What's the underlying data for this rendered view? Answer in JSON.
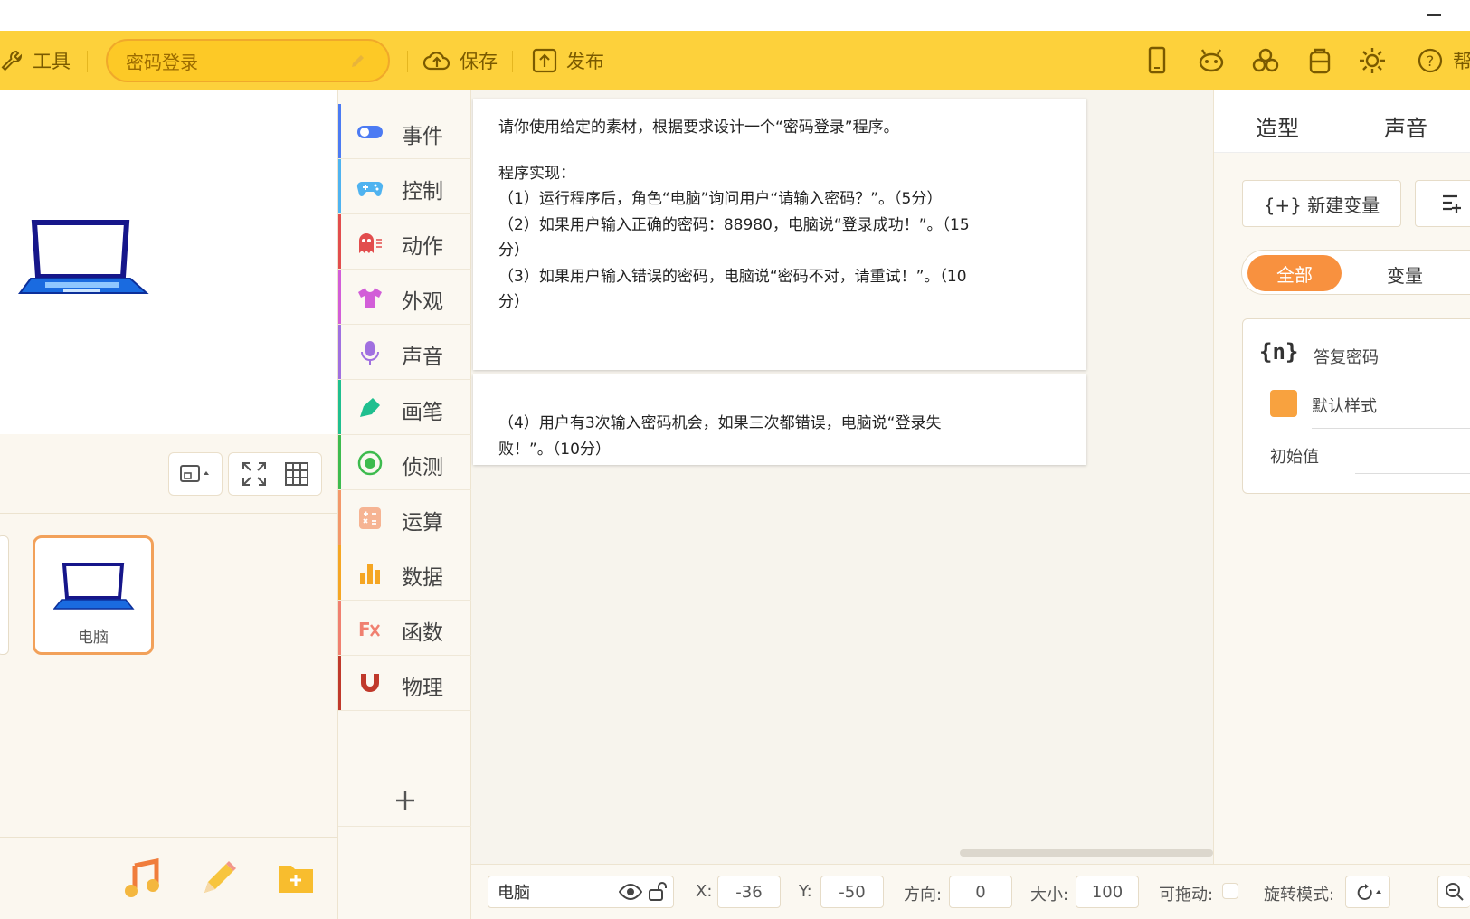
{
  "toolbar": {
    "tools_label": "工具",
    "project_name": "密码登录",
    "save_label": "保存",
    "publish_label": "发布",
    "help_label": "帮"
  },
  "stage": {
    "sprite_name": "电脑"
  },
  "categories": [
    {
      "label": "事件",
      "color": "#4c7bf3"
    },
    {
      "label": "控制",
      "color": "#4fb3f0"
    },
    {
      "label": "动作",
      "color": "#e24d4d"
    },
    {
      "label": "外观",
      "color": "#d25ed8"
    },
    {
      "label": "声音",
      "color": "#a070e0"
    },
    {
      "label": "画笔",
      "color": "#1fbf8f"
    },
    {
      "label": "侦测",
      "color": "#3dbb4e"
    },
    {
      "label": "运算",
      "color": "#f3986a"
    },
    {
      "label": "数据",
      "color": "#f5a623"
    },
    {
      "label": "函数",
      "color": "#f08070"
    },
    {
      "label": "物理",
      "color": "#c0392b"
    }
  ],
  "task": {
    "intro": "请你使用给定的素材，根据要求设计一个“密码登录”程序。",
    "heading": "程序实现：",
    "item1": "（1）运行程序后，角色“电脑”询问用户“请输入密码？”。（5分）",
    "item2a": "（2）如果用户输入正确的密码：88980，电脑说“登录成功！”。（15",
    "item2b": "分）",
    "item3a": "（3）如果用户输入错误的密码，电脑说“密码不对，请重试！”。（10",
    "item3b": "分）",
    "item4a": "（4）用户有3次输入密码机会，如果三次都错误，电脑说“登录失",
    "item4b": "败！”。（10分）"
  },
  "right_panel": {
    "tab_costume": "造型",
    "tab_sound": "声音",
    "new_variable": "{+} 新建变量",
    "filter_all": "全部",
    "filter_variable": "变量",
    "variable_name": "答复密码",
    "variable_style": "默认样式",
    "initial_value_label": "初始值",
    "brace_glyph": "{n}"
  },
  "status": {
    "sprite_name": "电脑",
    "x_label": "X:",
    "x_value": "-36",
    "y_label": "Y:",
    "y_value": "-50",
    "direction_label": "方向:",
    "direction_value": "0",
    "size_label": "大小:",
    "size_value": "100",
    "draggable_label": "可拖动:",
    "rotation_label": "旋转模式:"
  },
  "colors": {
    "toolbar": "#fdd13b",
    "accent_orange": "#f8913f"
  }
}
